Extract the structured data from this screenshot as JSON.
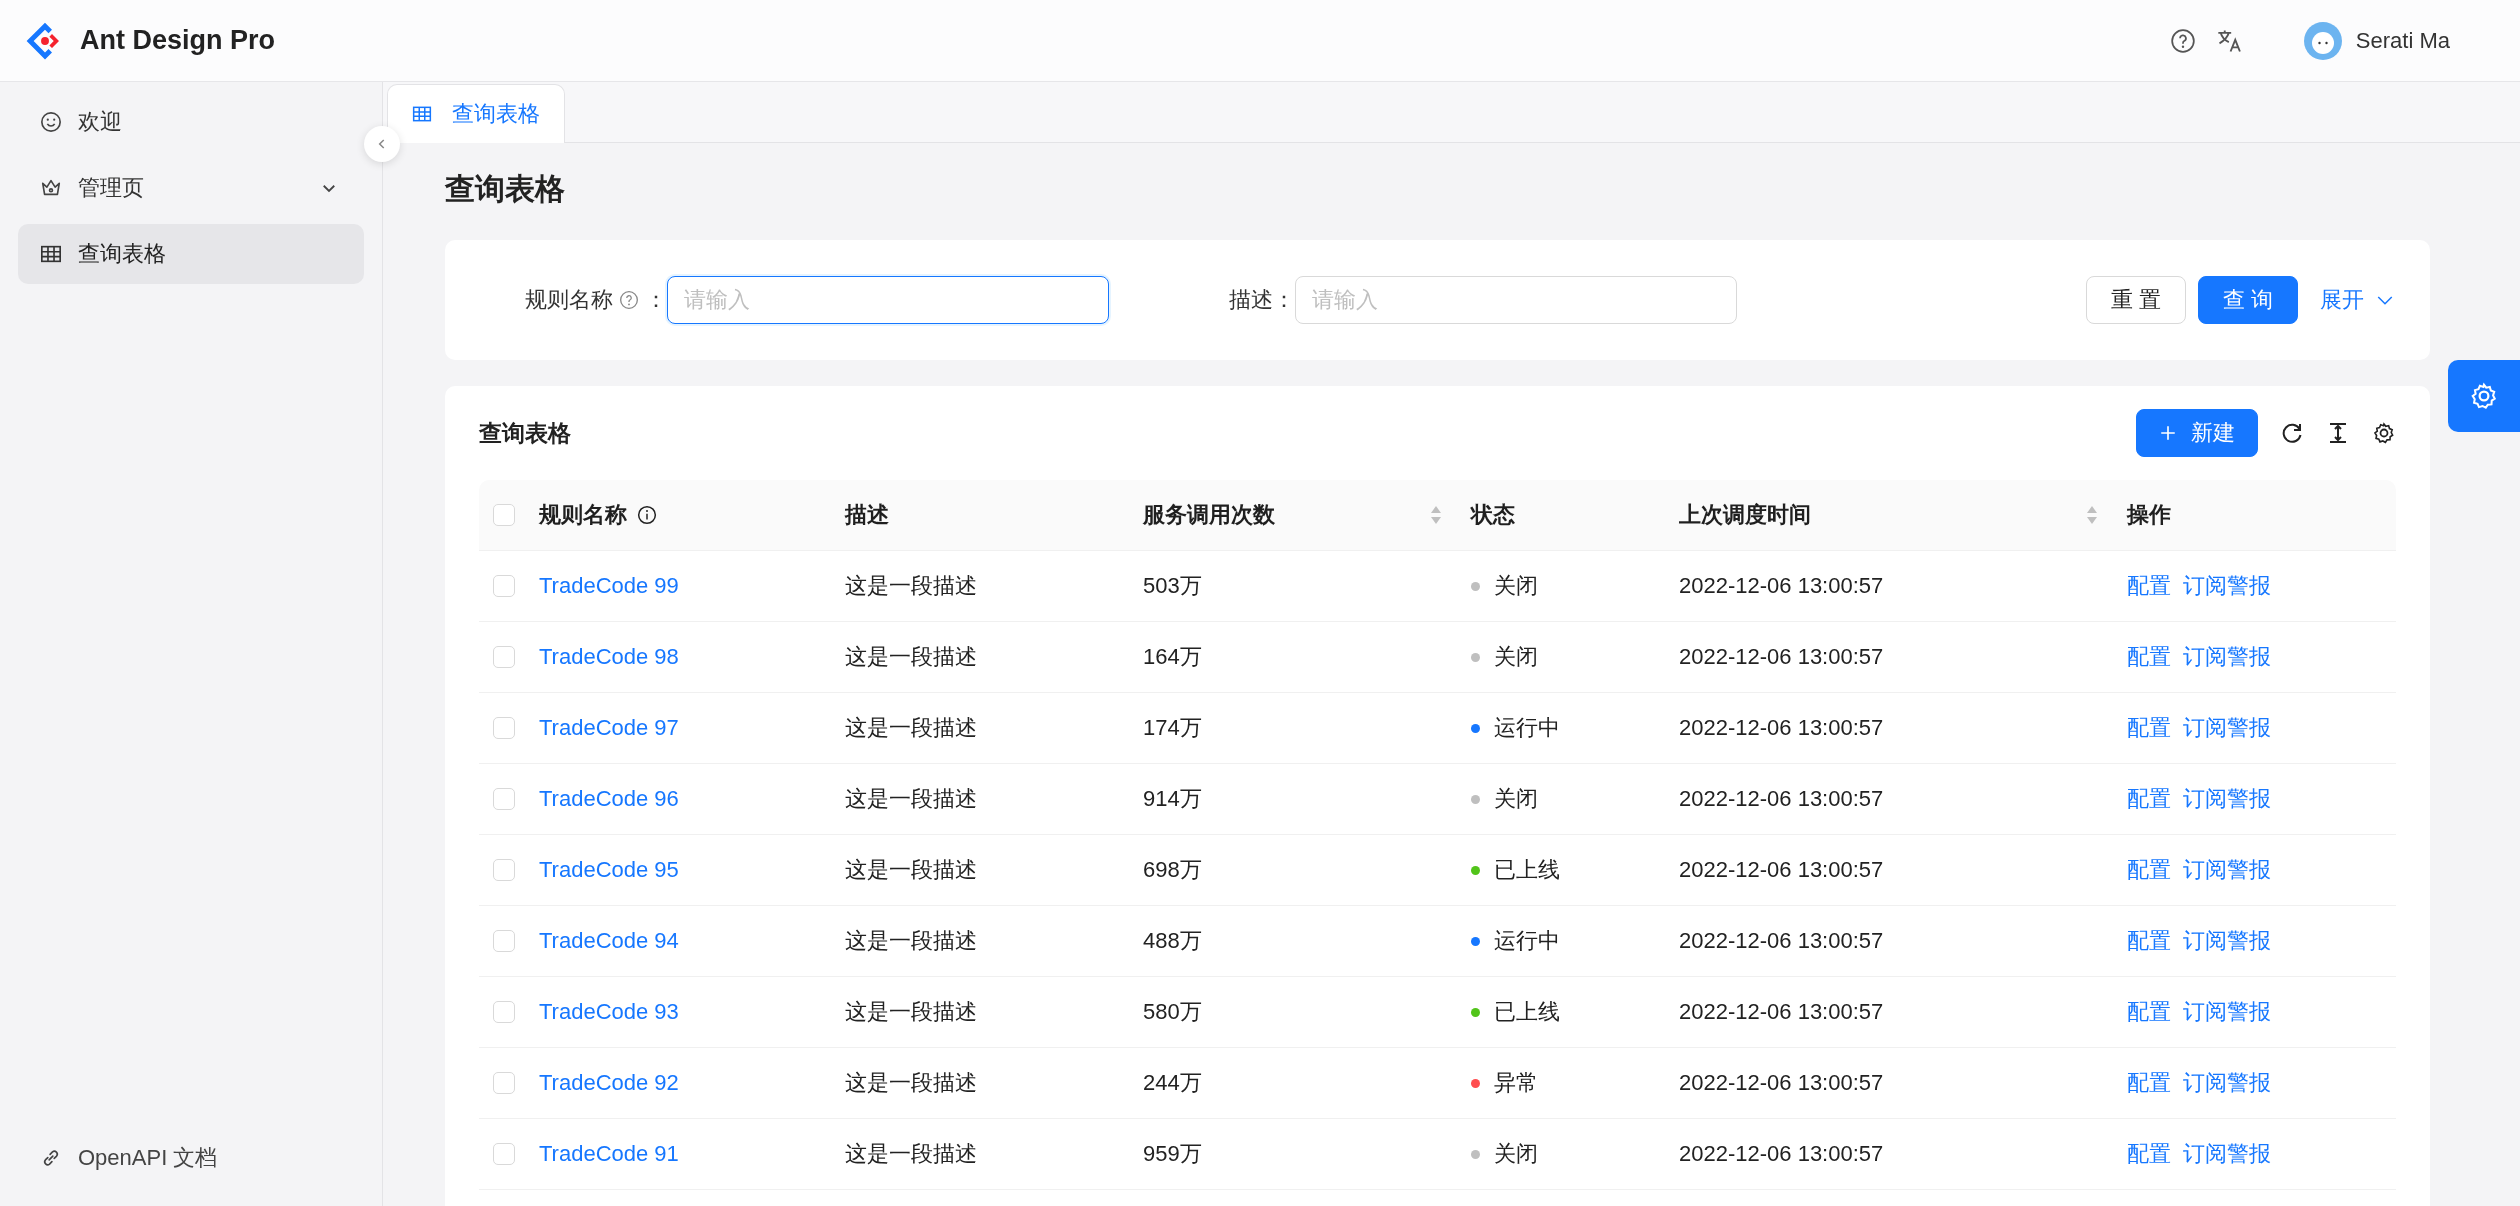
{
  "header": {
    "title": "Ant Design Pro",
    "user": "Serati Ma"
  },
  "sidebar": {
    "items": [
      {
        "label": "欢迎",
        "kind": "smile",
        "selected": false
      },
      {
        "label": "管理页",
        "kind": "crown",
        "selected": false,
        "expanded": false
      },
      {
        "label": "查询表格",
        "kind": "table",
        "selected": true
      }
    ],
    "footer_link": "OpenAPI 文档"
  },
  "tabs": [
    {
      "label": "查询表格",
      "selected": true
    }
  ],
  "page_title": "查询表格",
  "search_form": {
    "fields": [
      {
        "label": "规则名称",
        "help": true,
        "colon": "：",
        "placeholder": "请输入",
        "focused": true
      },
      {
        "label": "描述",
        "help": false,
        "colon": "：",
        "placeholder": "请输入",
        "focused": false
      }
    ],
    "buttons": [
      {
        "label": "重 置",
        "kind": "default"
      },
      {
        "label": "查 询",
        "kind": "primary"
      }
    ],
    "expand_link": "展开"
  },
  "table": {
    "title": "查询表格",
    "new_button": "新建",
    "header_checked": false,
    "columns": [
      {
        "label": "规则名称",
        "info": true,
        "sortable": false
      },
      {
        "label": "描述",
        "info": false,
        "sortable": false
      },
      {
        "label": "服务调用次数",
        "info": false,
        "sortable": true
      },
      {
        "label": "状态",
        "info": false,
        "sortable": false
      },
      {
        "label": "上次调度时间",
        "info": false,
        "sortable": true
      },
      {
        "label": "操作",
        "info": false,
        "sortable": false
      }
    ],
    "rows": [
      {
        "checked": false,
        "name": "TradeCode 99",
        "desc": "这是一段描述",
        "calls": "503万",
        "status": "关闭",
        "color": "#bfbfbf",
        "time": "2022-12-06 13:00:57",
        "actions": [
          "配置",
          "订阅警报"
        ]
      },
      {
        "checked": false,
        "name": "TradeCode 98",
        "desc": "这是一段描述",
        "calls": "164万",
        "status": "关闭",
        "color": "#bfbfbf",
        "time": "2022-12-06 13:00:57",
        "actions": [
          "配置",
          "订阅警报"
        ]
      },
      {
        "checked": false,
        "name": "TradeCode 97",
        "desc": "这是一段描述",
        "calls": "174万",
        "status": "运行中",
        "color": "#1677ff",
        "time": "2022-12-06 13:00:57",
        "actions": [
          "配置",
          "订阅警报"
        ]
      },
      {
        "checked": false,
        "name": "TradeCode 96",
        "desc": "这是一段描述",
        "calls": "914万",
        "status": "关闭",
        "color": "#bfbfbf",
        "time": "2022-12-06 13:00:57",
        "actions": [
          "配置",
          "订阅警报"
        ]
      },
      {
        "checked": false,
        "name": "TradeCode 95",
        "desc": "这是一段描述",
        "calls": "698万",
        "status": "已上线",
        "color": "#52c41a",
        "time": "2022-12-06 13:00:57",
        "actions": [
          "配置",
          "订阅警报"
        ]
      },
      {
        "checked": false,
        "name": "TradeCode 94",
        "desc": "这是一段描述",
        "calls": "488万",
        "status": "运行中",
        "color": "#1677ff",
        "time": "2022-12-06 13:00:57",
        "actions": [
          "配置",
          "订阅警报"
        ]
      },
      {
        "checked": false,
        "name": "TradeCode 93",
        "desc": "这是一段描述",
        "calls": "580万",
        "status": "已上线",
        "color": "#52c41a",
        "time": "2022-12-06 13:00:57",
        "actions": [
          "配置",
          "订阅警报"
        ]
      },
      {
        "checked": false,
        "name": "TradeCode 92",
        "desc": "这是一段描述",
        "calls": "244万",
        "status": "异常",
        "color": "#ff4d4f",
        "time": "2022-12-06 13:00:57",
        "actions": [
          "配置",
          "订阅警报"
        ]
      },
      {
        "checked": false,
        "name": "TradeCode 91",
        "desc": "这是一段描述",
        "calls": "959万",
        "status": "关闭",
        "color": "#bfbfbf",
        "time": "2022-12-06 13:00:57",
        "actions": [
          "配置",
          "订阅警报"
        ]
      }
    ]
  }
}
